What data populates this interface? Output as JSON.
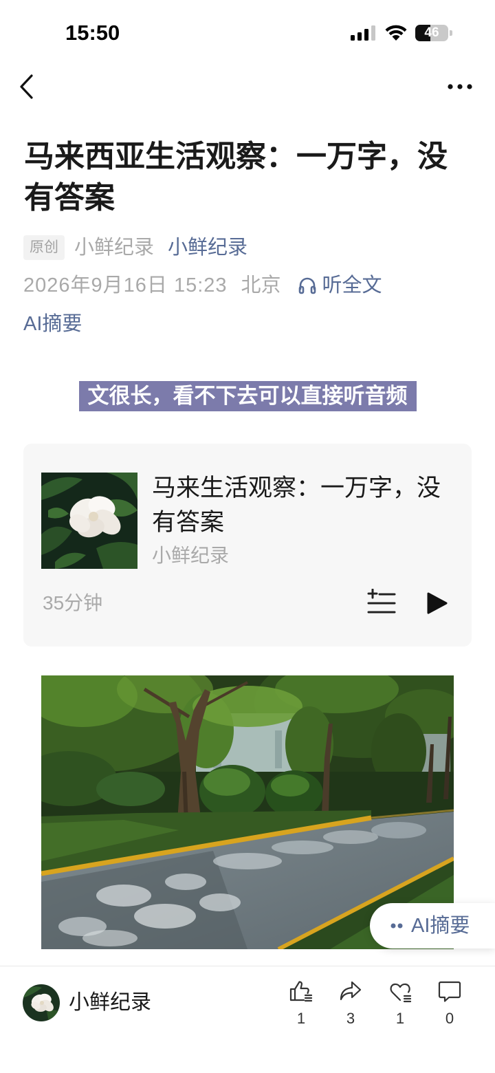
{
  "status_bar": {
    "time": "15:50",
    "battery": "46",
    "icons": [
      "signal-icon",
      "wifi-icon",
      "battery-icon"
    ]
  },
  "nav": {
    "back_icon": "chevron-left-icon",
    "more_icon": "more-dots-icon"
  },
  "article": {
    "title": "马来西亚生活观察：一万字，没有答案",
    "original_tag": "原创",
    "author": "小鲜纪录",
    "account": "小鲜纪录",
    "date": "2026年9月16日 15:23",
    "location": "北京",
    "listen_icon": "headphones-icon",
    "listen_label": "听全文",
    "ai_summary_label": "AI摘要",
    "highlight_text": "文很长，看不下去可以直接听音频"
  },
  "audio_card": {
    "title": "马来生活观察：一万字，没有答案",
    "author": "小鲜纪录",
    "duration": "35分钟",
    "action_icons": [
      "playlist-add-icon",
      "play-icon"
    ]
  },
  "floating_ai_button": {
    "icon": "ai-dots-icon",
    "label": "AI摘要"
  },
  "bottom_bar": {
    "account_name": "小鲜纪录",
    "actions": [
      {
        "icon": "thumbs-up-icon",
        "count": "1"
      },
      {
        "icon": "share-icon",
        "count": "3"
      },
      {
        "icon": "like-heart-icon",
        "count": "1"
      },
      {
        "icon": "comment-icon",
        "count": "0"
      }
    ]
  },
  "colors": {
    "link": "#576b95",
    "highlight_bg": "#7c7bab",
    "muted_text": "#a9a9a9",
    "card_bg": "#f7f7f7",
    "text": "#1a1a1a"
  }
}
